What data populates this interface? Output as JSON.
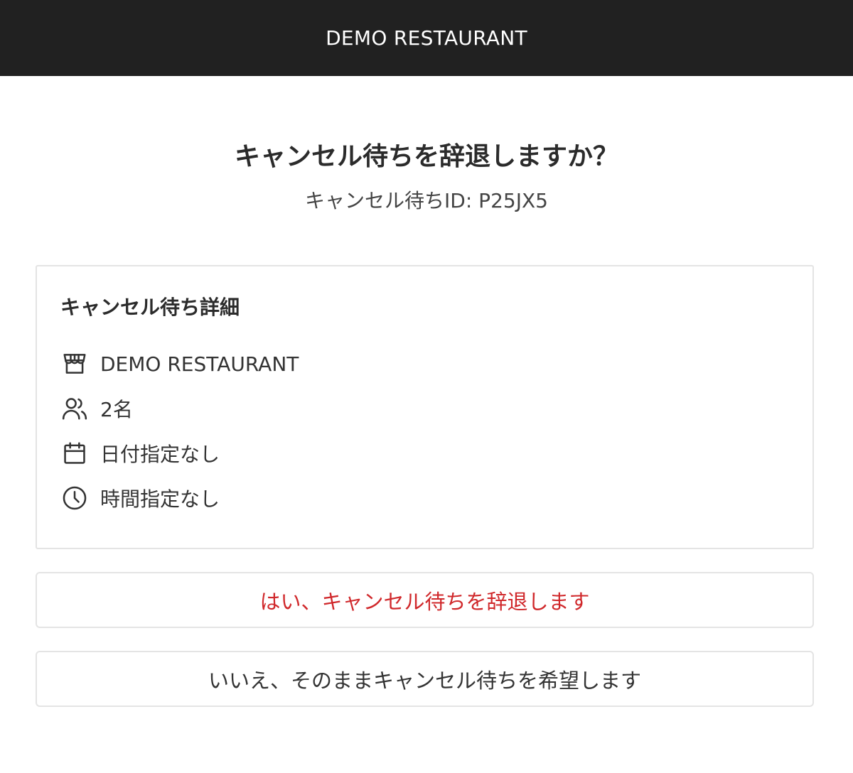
{
  "header": {
    "title": "DEMO RESTAURANT"
  },
  "dialog": {
    "heading": "キャンセル待ちを辞退しますか？",
    "waitlist_id_label": "キャンセル待ちID: P25JX5"
  },
  "details": {
    "title": "キャンセル待ち詳細",
    "items": [
      {
        "icon": "store-icon",
        "label": "DEMO RESTAURANT"
      },
      {
        "icon": "people-icon",
        "label": "2名"
      },
      {
        "icon": "calendar-icon",
        "label": "日付指定なし"
      },
      {
        "icon": "clock-icon",
        "label": "時間指定なし"
      }
    ]
  },
  "actions": {
    "decline_label": "はい、キャンセル待ちを辞退します",
    "keep_label": "いいえ、そのままキャンセル待ちを希望します"
  },
  "colors": {
    "header_bg": "#212121",
    "decline_text": "#d0282b",
    "border": "#e4e4e4"
  }
}
